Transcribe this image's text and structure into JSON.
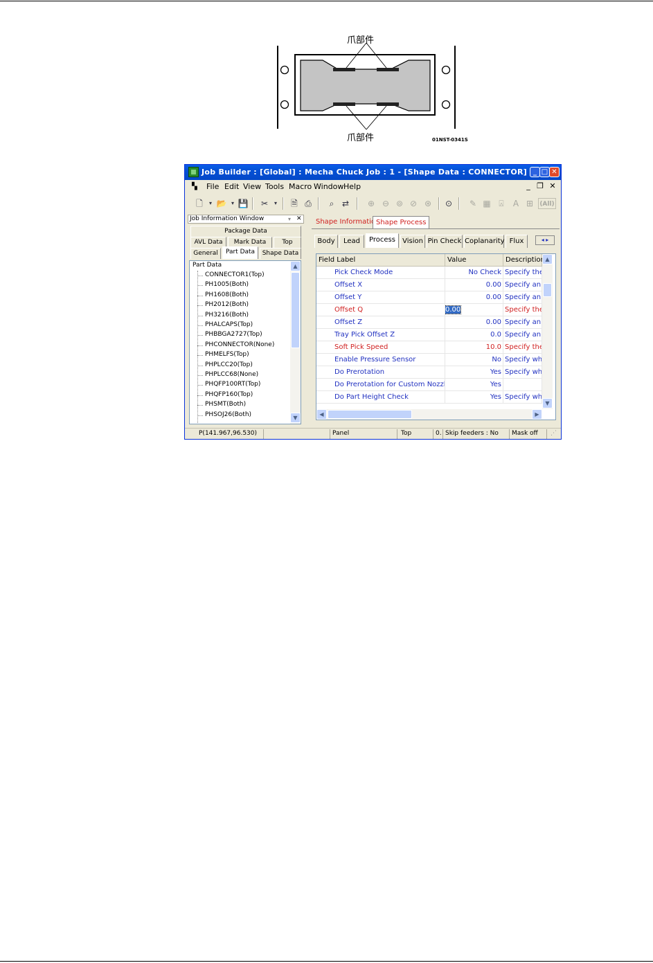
{
  "diagram": {
    "label_top": "爪部件",
    "label_bottom": "爪部件",
    "code": "01NST-0341S"
  },
  "window": {
    "title": "Job Builder : [Global] : Mecha Chuck Job : 1 - [Shape Data : CONNECTOR]",
    "menu": [
      "File",
      "Edit",
      "View",
      "Tools",
      "Macro",
      "Window",
      "Help"
    ],
    "toolbar_icons": [
      "new-icon",
      "open-icon",
      "save-icon",
      "cut-icon",
      "print-preview-icon",
      "print-icon",
      "find-icon",
      "replace-icon",
      "zoom-in-icon",
      "zoom-out-icon",
      "zoom-fit-icon",
      "zoom-prev-icon",
      "zoom-next-icon",
      "zoom-window-icon",
      "measure-icon",
      "grid-icon",
      "text-icon",
      "font-icon",
      "table-icon"
    ],
    "toolbar_all_label": "(All)"
  },
  "left_panel": {
    "header": "Job Information Window",
    "tabs_row1": [
      "Package Data"
    ],
    "tabs_row2": [
      "AVL Data",
      "Mark Data",
      "Top"
    ],
    "tabs_row3": [
      "General",
      "Part Data",
      "Shape Data"
    ],
    "tree_root": "Part Data",
    "tree_items": [
      "CONNECTOR1(Top)",
      "PH1005(Both)",
      "PH1608(Both)",
      "PH2012(Both)",
      "PH3216(Both)",
      "PHALCAPS(Top)",
      "PHBBGA2727(Top)",
      "PHCONNECTOR(None)",
      "PHMELFS(Top)",
      "PHPLCC20(Top)",
      "PHPLCC68(None)",
      "PHQFP100RT(Top)",
      "PHQFP160(Top)",
      "PHSMT(Both)",
      "PHSOJ26(Both)"
    ]
  },
  "right_panel": {
    "top_tabs": [
      "Shape Information",
      "Shape Process"
    ],
    "sub_tabs": [
      "Body",
      "Lead",
      "Process",
      "Vision",
      "Pin Check",
      "Coplanarity",
      "Flux"
    ],
    "columns": [
      "Field Label",
      "Value",
      "Description"
    ],
    "rows": [
      {
        "label": "Pick Check Mode",
        "value": "No Check",
        "desc": "Specify the",
        "color": "blue"
      },
      {
        "label": "Offset X",
        "value": "0.00",
        "desc": "Specify an o",
        "color": "blue"
      },
      {
        "label": "Offset Y",
        "value": "0.00",
        "desc": "Specify an o",
        "color": "blue"
      },
      {
        "label": "Offset Q",
        "value": "0.00",
        "desc": "Specify the",
        "color": "red"
      },
      {
        "label": "Offset Z",
        "value": "0.00",
        "desc": "Specify an o",
        "color": "blue"
      },
      {
        "label": "Tray Pick Offset Z",
        "value": "0.0",
        "desc": "Specify an o",
        "color": "blue"
      },
      {
        "label": "Soft Pick Speed",
        "value": "10.0",
        "desc": "Specify the",
        "color": "red"
      },
      {
        "label": "Enable Pressure Sensor",
        "value": "No",
        "desc": "Specify whe",
        "color": "blue"
      },
      {
        "label": "Do Prerotation",
        "value": "Yes",
        "desc": "Specify whe",
        "color": "blue"
      },
      {
        "label": "Do Prerotation for Custom Nozzle",
        "value": "Yes",
        "desc": "",
        "color": "blue"
      },
      {
        "label": "Do Part Height Check",
        "value": "Yes",
        "desc": "Specify whe",
        "color": "blue"
      }
    ]
  },
  "status_bar": [
    "P(141.967,96.530)",
    "",
    "Panel",
    "Top",
    "0.",
    "Skip feeders : No",
    "Mask off"
  ]
}
